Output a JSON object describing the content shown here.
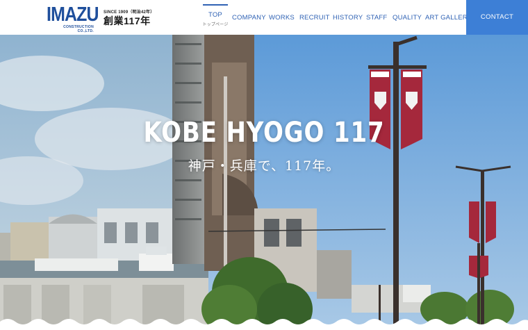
{
  "logo": {
    "brand": "IMAZU",
    "company": "CONSTRUCTION CO.,LTD.",
    "since": "SINCE 1909（明治42年）",
    "years": "創業117年"
  },
  "nav": {
    "items": [
      {
        "label": "TOP",
        "sublabel": "トップページ"
      },
      {
        "label": "COMPANY"
      },
      {
        "label": "WORKS"
      },
      {
        "label": "RECRUIT"
      },
      {
        "label": "HISTORY"
      },
      {
        "label": "STAFF"
      },
      {
        "label": "QUALITY"
      },
      {
        "label": "ART GALLERY"
      }
    ],
    "contact": "CONTACT"
  },
  "hero": {
    "title": "KOBE HYOGO 117",
    "subtitle": "神戸・兵庫で、117年。"
  },
  "colors": {
    "brand_blue": "#1f4f9c",
    "nav_blue": "#2f62b4",
    "contact_bg": "#3d7fd6",
    "banner_red": "#a5283c"
  }
}
